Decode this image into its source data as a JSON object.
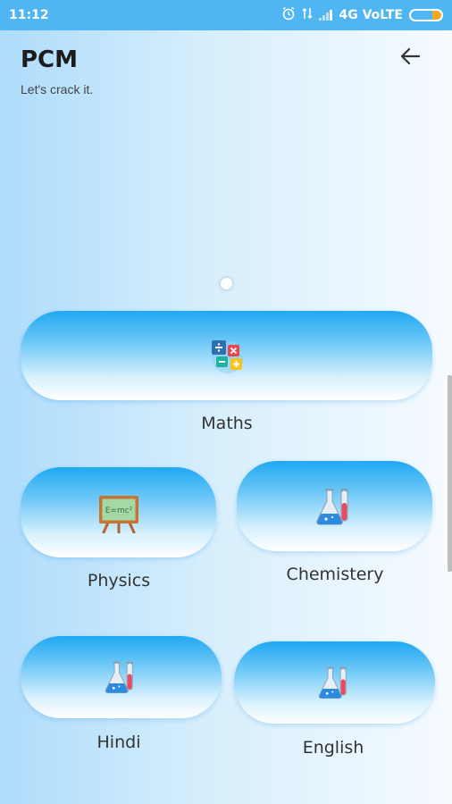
{
  "status_bar": {
    "time": "11:12",
    "network": "4G VoLTE"
  },
  "header": {
    "title": "PCM",
    "subtitle": "Let's crack it."
  },
  "subjects": [
    {
      "label": "Maths",
      "icon": "math-operations-icon"
    },
    {
      "label": "Physics",
      "icon": "chalkboard-icon",
      "board_text": "E=mc²"
    },
    {
      "label": "Chemistery",
      "icon": "lab-flask-icon"
    },
    {
      "label": "Hindi",
      "icon": "lab-flask-icon"
    },
    {
      "label": "English",
      "icon": "lab-flask-icon"
    }
  ],
  "colors": {
    "status_bar": "#4fb6f3",
    "card_top": "#20a8f2",
    "card_bottom": "#ffffff"
  }
}
